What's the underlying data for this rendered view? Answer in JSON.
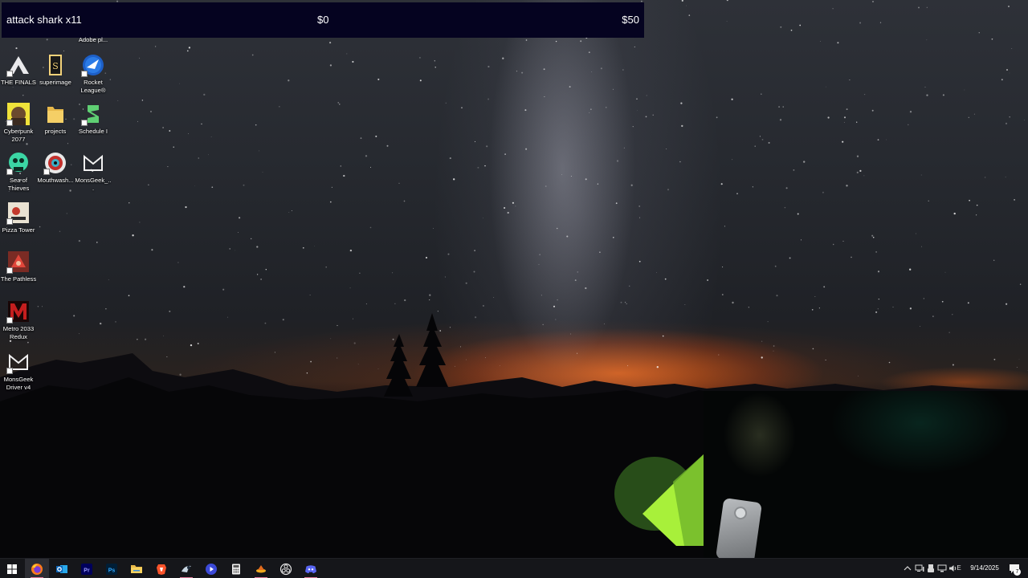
{
  "price_widget": {
    "product_name": "attack shark x11",
    "current_amount": "$0",
    "goal_amount": "$50"
  },
  "desktop": {
    "partial_label": "Adobe pl...",
    "icons": [
      {
        "label": "THE FINALS",
        "icon": "the-finals-icon"
      },
      {
        "label": "superimage",
        "icon": "superimage-icon"
      },
      {
        "label": "Rocket League®",
        "icon": "rocket-league-icon"
      },
      {
        "label": "Cyberpunk 2077",
        "icon": "cyberpunk-icon"
      },
      {
        "label": "projects",
        "icon": "folder-icon"
      },
      {
        "label": "Schedule I",
        "icon": "schedule-one-icon"
      },
      {
        "label": "Sea of Thieves",
        "icon": "sea-of-thieves-icon"
      },
      {
        "label": "Mouthwash...",
        "icon": "mouthwash-icon"
      },
      {
        "label": "MonsGeek_...",
        "icon": "monsgeek-icon"
      },
      {
        "label": "Pizza Tower",
        "icon": "pizza-tower-icon"
      },
      {
        "label": "The Pathless",
        "icon": "the-pathless-icon"
      },
      {
        "label": "Metro 2033 Redux",
        "icon": "metro-2033-icon"
      },
      {
        "label": "MonsGeek Driver v4",
        "icon": "monsgeek-driver-icon"
      }
    ]
  },
  "taskbar": {
    "apps": [
      {
        "icon": "windows-start-icon"
      },
      {
        "icon": "firefox-icon"
      },
      {
        "icon": "outlook-icon"
      },
      {
        "icon": "premiere-pro-icon",
        "text": "Pr"
      },
      {
        "icon": "photoshop-icon",
        "text": "Ps"
      },
      {
        "icon": "file-explorer-icon"
      },
      {
        "icon": "brave-icon"
      },
      {
        "icon": "steam-icon"
      },
      {
        "icon": "media-player-icon"
      },
      {
        "icon": "calculator-icon"
      },
      {
        "icon": "game-launcher-icon"
      },
      {
        "icon": "obs-icon"
      },
      {
        "icon": "discord-icon"
      }
    ],
    "tray": {
      "language_indicator": "ENG",
      "language_short": "E",
      "date": "9/14/2025",
      "notification_count": "7"
    }
  },
  "colors": {
    "widget_background": "#050320",
    "taskbar_background": "#15161a",
    "running_indicator": "#e07a9a"
  }
}
